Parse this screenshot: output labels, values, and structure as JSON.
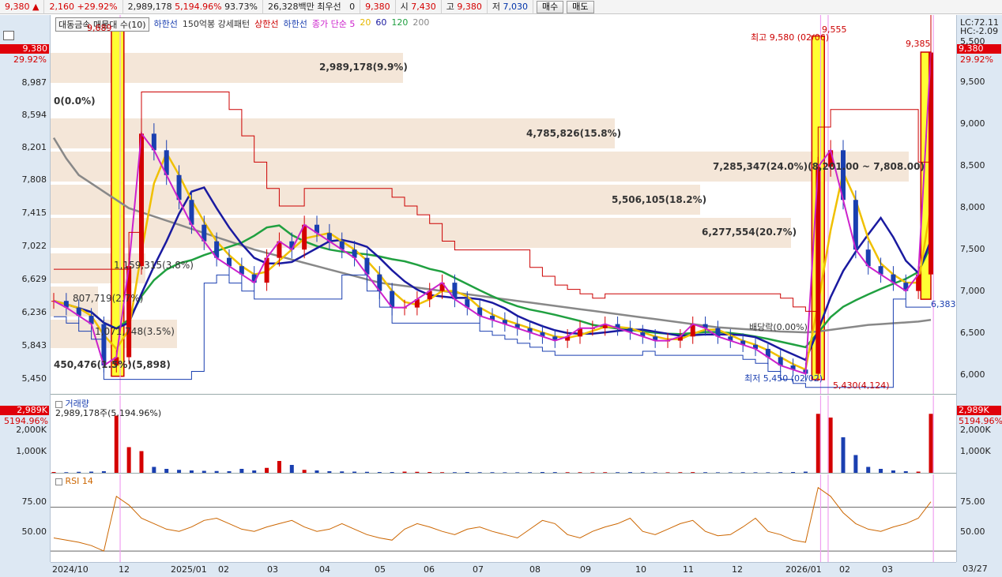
{
  "topbar": {
    "price": "9,380",
    "change": "2,160",
    "change_pct": "+29.92%",
    "volume": "2,989,178",
    "vol_ratio": "5,194.96%",
    "turnover": "93.73%",
    "amount": "26,328백만",
    "best_label": "최우선",
    "best_bid": "0",
    "best_ask": "9,380",
    "open_label": "시",
    "open": "7,430",
    "high_label": "고",
    "high": "9,380",
    "low_label": "저",
    "low": "7,030",
    "buy_label": "매수",
    "sell_label": "매도"
  },
  "legend": {
    "stock_name": "대동금속 매물대 수(10)",
    "items": [
      {
        "text": "하한선",
        "color": "#1a3fb0"
      },
      {
        "text": "150억봉 강세패턴",
        "color": "#333333"
      },
      {
        "text": "상한선",
        "color": "#cc0000"
      },
      {
        "text": "하한선",
        "color": "#1a3fb0"
      },
      {
        "text": "종가 단순 5",
        "color": "#cc22cc"
      },
      {
        "text": "20",
        "color": "#e6b800"
      },
      {
        "text": "60",
        "color": "#1a1aa0"
      },
      {
        "text": "120",
        "color": "#20a040"
      },
      {
        "text": "200",
        "color": "#888888"
      }
    ]
  },
  "price_axis": {
    "left_labels": [
      "8,987",
      "8,594",
      "8,201",
      "7,808",
      "7,415",
      "7,022",
      "6,629",
      "6,236",
      "5,843",
      "5,450"
    ],
    "right_labels": [
      "9,500",
      "9,000",
      "8,500",
      "8,000",
      "7,500",
      "7,000",
      "6,500",
      "6,000",
      "5,500"
    ],
    "current_price": "9,380",
    "current_pct": "29.92%",
    "lc": "LC:72.11",
    "hc": "HC:-2.09"
  },
  "volume_profile": [
    {
      "label": "2,989,178(9.9%)"
    },
    {
      "label": "0(0.0%)"
    },
    {
      "label": "4,785,826(15.8%)"
    },
    {
      "label": "7,285,347(24.0%)(8,201.00 ~ 7,808.00)"
    },
    {
      "label": "5,506,105(18.2%)"
    },
    {
      "label": "6,277,554(20.7%)"
    },
    {
      "label": "1,159,315(3.8%)"
    },
    {
      "label": "807,719(2.7%)"
    },
    {
      "label": "1,071,748(3.5%)"
    },
    {
      "label": "450,476(1.5%)(5,898)"
    }
  ],
  "annotations": {
    "high_left": "9,689",
    "high_peak": "9,555",
    "high_recent": "9,385",
    "max_label": "최고 9,580 (02/06)",
    "min_label": "최저 5,450 (02/02)",
    "low_mark": "5,430(4,124)",
    "dividend": "배당락(0.00%)",
    "right_mark": "6,383(3,"
  },
  "volume_panel": {
    "title": "거래량",
    "value": "2,989,178주(5,194.96%)",
    "left_tag": "2,989K",
    "left_pct": "5194.96%",
    "right_tag": "2,989K",
    "right_pct": "5194.96%",
    "labels": [
      "2,000K",
      "1,000K"
    ]
  },
  "rsi_panel": {
    "title": "RSI 14",
    "labels": [
      "75.00",
      "50.00"
    ]
  },
  "x_axis": [
    "2024/10",
    "12",
    "2025/01",
    "02",
    "03",
    "04",
    "05",
    "06",
    "07",
    "08",
    "09",
    "10",
    "11",
    "12",
    "2026/01",
    "02",
    "03",
    "03/27"
  ],
  "colors": {
    "up": "#d40000",
    "down": "#1a3fb0",
    "ma5": "#cc22cc",
    "ma20": "#f0c000",
    "ma60": "#1a1aa0",
    "ma120": "#20a040",
    "ma200": "#888888",
    "upper": "#cc0000",
    "highlight": "#ffff33"
  },
  "chart_data": {
    "type": "line",
    "title": "대동금속",
    "ylim": [
      5400,
      9700
    ],
    "price_close": [
      6380,
      6300,
      6200,
      6100,
      5600,
      5700,
      6800,
      8400,
      8200,
      7900,
      7600,
      7300,
      7100,
      6900,
      6800,
      6700,
      6600,
      6900,
      7100,
      7000,
      7300,
      7200,
      7100,
      7000,
      6900,
      6700,
      6500,
      6300,
      6300,
      6400,
      6500,
      6600,
      6400,
      6300,
      6200,
      6150,
      6100,
      6050,
      6000,
      5950,
      5900,
      5950,
      6050,
      6050,
      6100,
      6050,
      6000,
      5950,
      5900,
      5900,
      5950,
      6100,
      6050,
      5950,
      5900,
      5850,
      5800,
      5700,
      5600,
      5550,
      5500,
      8000,
      8200,
      7600,
      7000,
      6800,
      6700,
      6600,
      6500,
      6700,
      9380
    ],
    "ma200": [
      8350,
      8100,
      7900,
      7800,
      7700,
      7600,
      7500,
      7450,
      7400,
      7350,
      7300,
      7250,
      7200,
      7150,
      7100,
      7050,
      7000,
      6960,
      6920,
      6880,
      6840,
      6800,
      6760,
      6720,
      6680,
      6640,
      6600,
      6580,
      6560,
      6540,
      6520,
      6500,
      6480,
      6460,
      6440,
      6420,
      6400,
      6380,
      6360,
      6340,
      6320,
      6300,
      6280,
      6260,
      6240,
      6220,
      6200,
      6180,
      6160,
      6140,
      6120,
      6100,
      6080,
      6060,
      6050,
      6040,
      6030,
      6020,
      6010,
      6005,
      6000,
      6010,
      6030,
      6050,
      6070,
      6090,
      6100,
      6110,
      6120,
      6130,
      6150
    ],
    "rsi": [
      42,
      40,
      38,
      35,
      30,
      80,
      72,
      60,
      55,
      50,
      48,
      52,
      58,
      60,
      55,
      50,
      48,
      52,
      55,
      58,
      52,
      48,
      50,
      55,
      50,
      45,
      42,
      40,
      50,
      55,
      52,
      48,
      45,
      50,
      52,
      48,
      45,
      42,
      50,
      58,
      55,
      45,
      42,
      48,
      52,
      55,
      60,
      48,
      45,
      50,
      55,
      58,
      48,
      44,
      45,
      52,
      60,
      48,
      45,
      40,
      38,
      88,
      80,
      65,
      55,
      50,
      48,
      52,
      55,
      60,
      75
    ],
    "volume": [
      40,
      30,
      50,
      60,
      80,
      2900,
      1300,
      1100,
      300,
      200,
      150,
      120,
      100,
      90,
      80,
      200,
      120,
      250,
      600,
      400,
      150,
      120,
      80,
      70,
      60,
      50,
      40,
      40,
      60,
      50,
      40,
      30,
      30,
      40,
      30,
      30,
      25,
      25,
      30,
      40,
      35,
      30,
      30,
      25,
      30,
      30,
      35,
      30,
      25,
      25,
      30,
      35,
      30,
      25,
      25,
      30,
      25,
      25,
      30,
      40,
      60,
      2989,
      2800,
      1800,
      900,
      300,
      200,
      120,
      80,
      60,
      2989
    ]
  }
}
